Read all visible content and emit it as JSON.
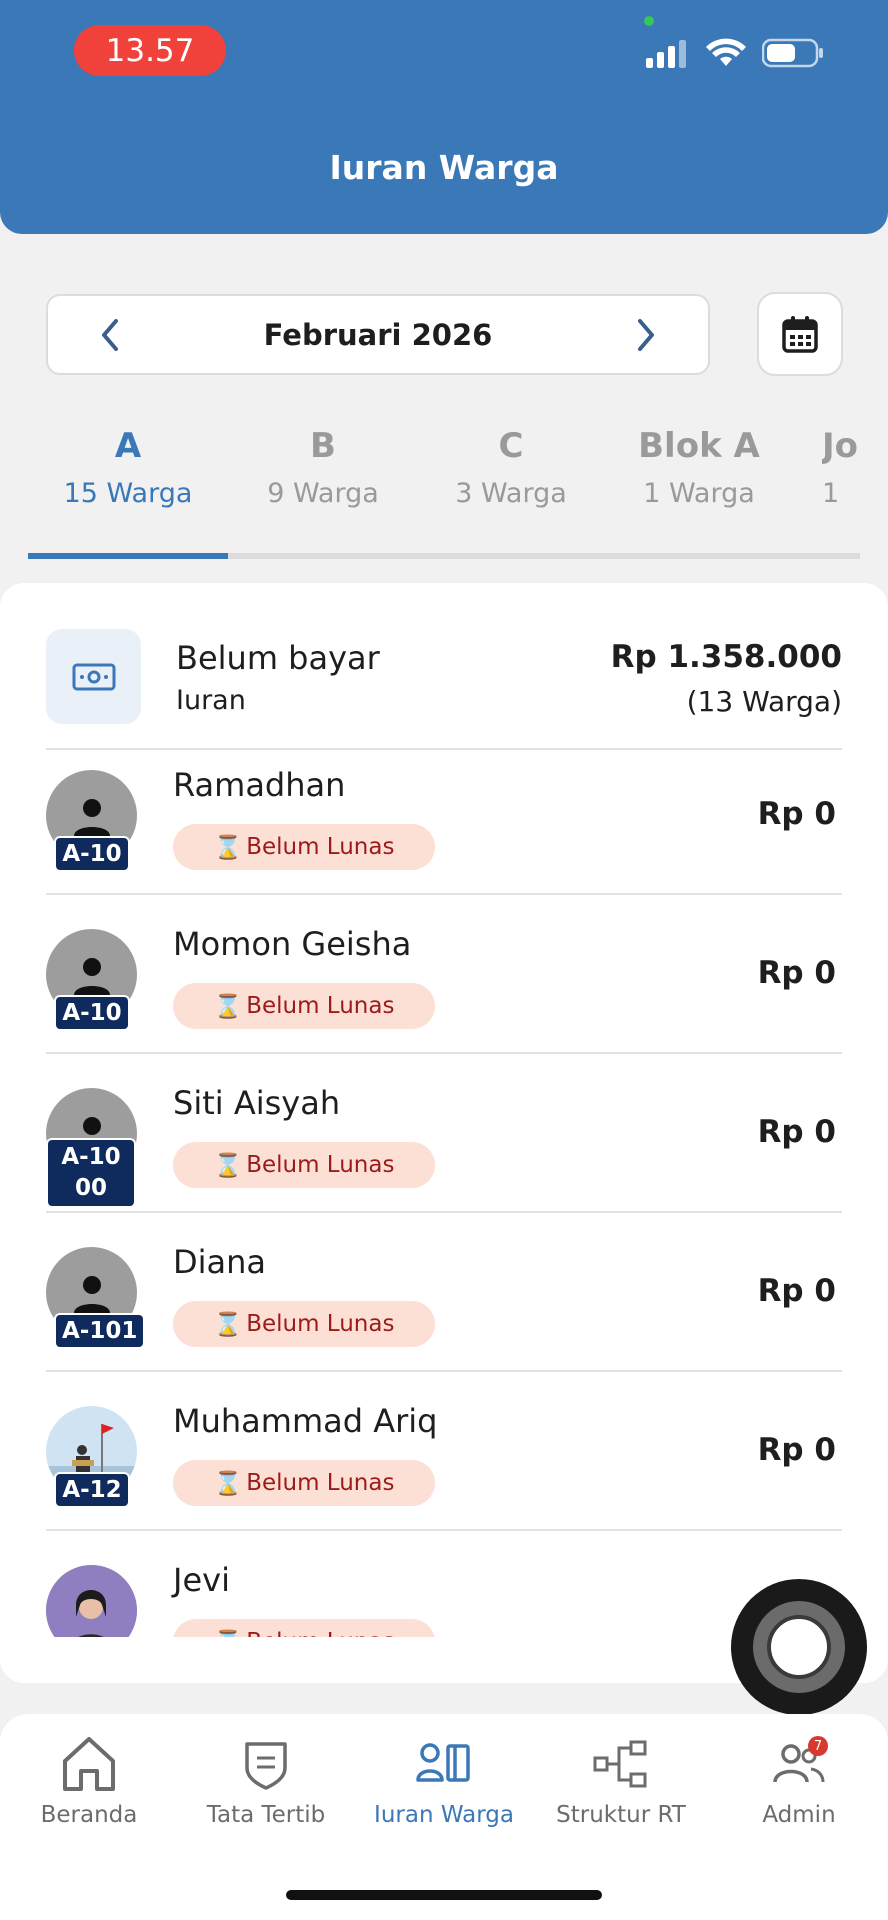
{
  "status_bar": {
    "time": "13.57"
  },
  "header": {
    "title": "Iuran Warga"
  },
  "month_selector": {
    "label": "Februari 2026"
  },
  "tabs": [
    {
      "name": "A",
      "count": "15 Warga",
      "active": true
    },
    {
      "name": "B",
      "count": "9 Warga",
      "active": false
    },
    {
      "name": "C",
      "count": "3 Warga",
      "active": false
    },
    {
      "name": "Blok A",
      "count": "1 Warga",
      "active": false
    },
    {
      "name": "Jo",
      "count": "1",
      "active": false
    }
  ],
  "summary": {
    "title": "Belum bayar",
    "subtitle": "Iuran",
    "amount": "Rp 1.358.000",
    "count": "(13 Warga)"
  },
  "residents": [
    {
      "name": "Ramadhan",
      "unit": "A-10",
      "status": "Belum Lunas",
      "amount": "Rp 0"
    },
    {
      "name": "Momon Geisha",
      "unit": "A-10",
      "status": "Belum Lunas",
      "amount": "Rp 0"
    },
    {
      "name": "Siti Aisyah",
      "unit": "A-10 00",
      "status": "Belum Lunas",
      "amount": "Rp 0"
    },
    {
      "name": "Diana",
      "unit": "A-101",
      "status": "Belum Lunas",
      "amount": "Rp 0"
    },
    {
      "name": "Muhammad Ariq",
      "unit": "A-12",
      "status": "Belum Lunas",
      "amount": "Rp 0"
    },
    {
      "name": "Jevi",
      "unit": "",
      "status": "Belum Lunas",
      "amount": ""
    }
  ],
  "bottom_nav": [
    {
      "label": "Beranda",
      "icon": "home-icon"
    },
    {
      "label": "Tata Tertib",
      "icon": "shield-icon"
    },
    {
      "label": "Iuran Warga",
      "icon": "resident-dues-icon",
      "active": true
    },
    {
      "label": "Struktur RT",
      "icon": "org-structure-icon"
    },
    {
      "label": "Admin",
      "icon": "admin-users-icon",
      "badge": "7"
    }
  ],
  "colors": {
    "primary": "#3a78b8",
    "status_bg": "#fde0d5",
    "status_text": "#9b1b1b",
    "badge_navy": "#0f2a5c"
  }
}
